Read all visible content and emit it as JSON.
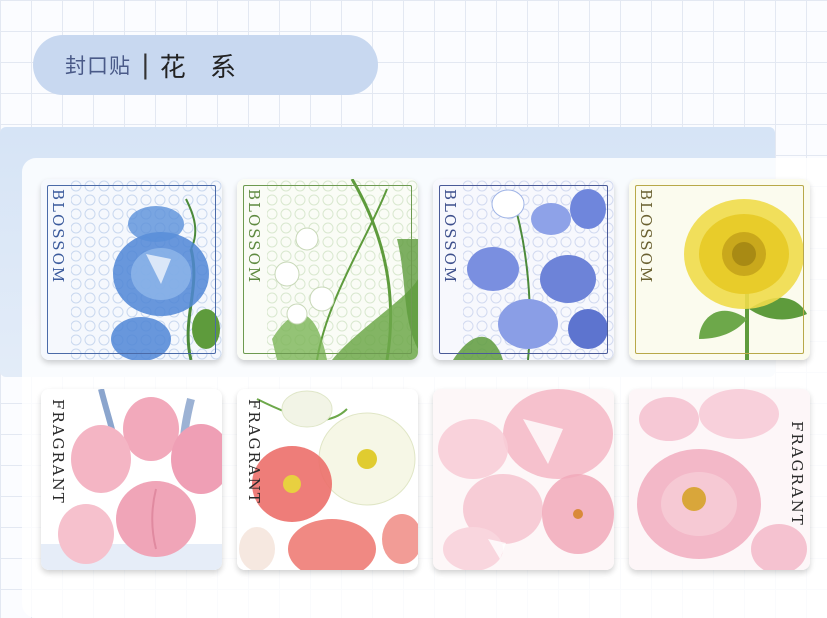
{
  "header": {
    "label": "封口贴",
    "separator": "|",
    "name": "花 系"
  },
  "row1": [
    {
      "text": "BLOSSOM",
      "flower": "blue-morning-glory"
    },
    {
      "text": "BLOSSOM",
      "flower": "lily-of-the-valley"
    },
    {
      "text": "BLOSSOM",
      "flower": "bellflower"
    },
    {
      "text": "BLOSSOM",
      "flower": "sunflower"
    }
  ],
  "row2": [
    {
      "text": "FRAGRANT",
      "flower": "pink-tulip"
    },
    {
      "text": "FRAGRANT",
      "flower": "red-poppy"
    },
    {
      "text": "",
      "flower": "cherry-blossom"
    },
    {
      "text": "FRAGRANT",
      "flower": "peony"
    }
  ],
  "colors": {
    "pill": "#c8d8f0",
    "blue": "#4f86d6",
    "green": "#5e9b3c",
    "periwinkle": "#7a8fe0",
    "yellow": "#e8cc2a",
    "pink": "#ef9fb5",
    "coral": "#ec6f6a"
  }
}
